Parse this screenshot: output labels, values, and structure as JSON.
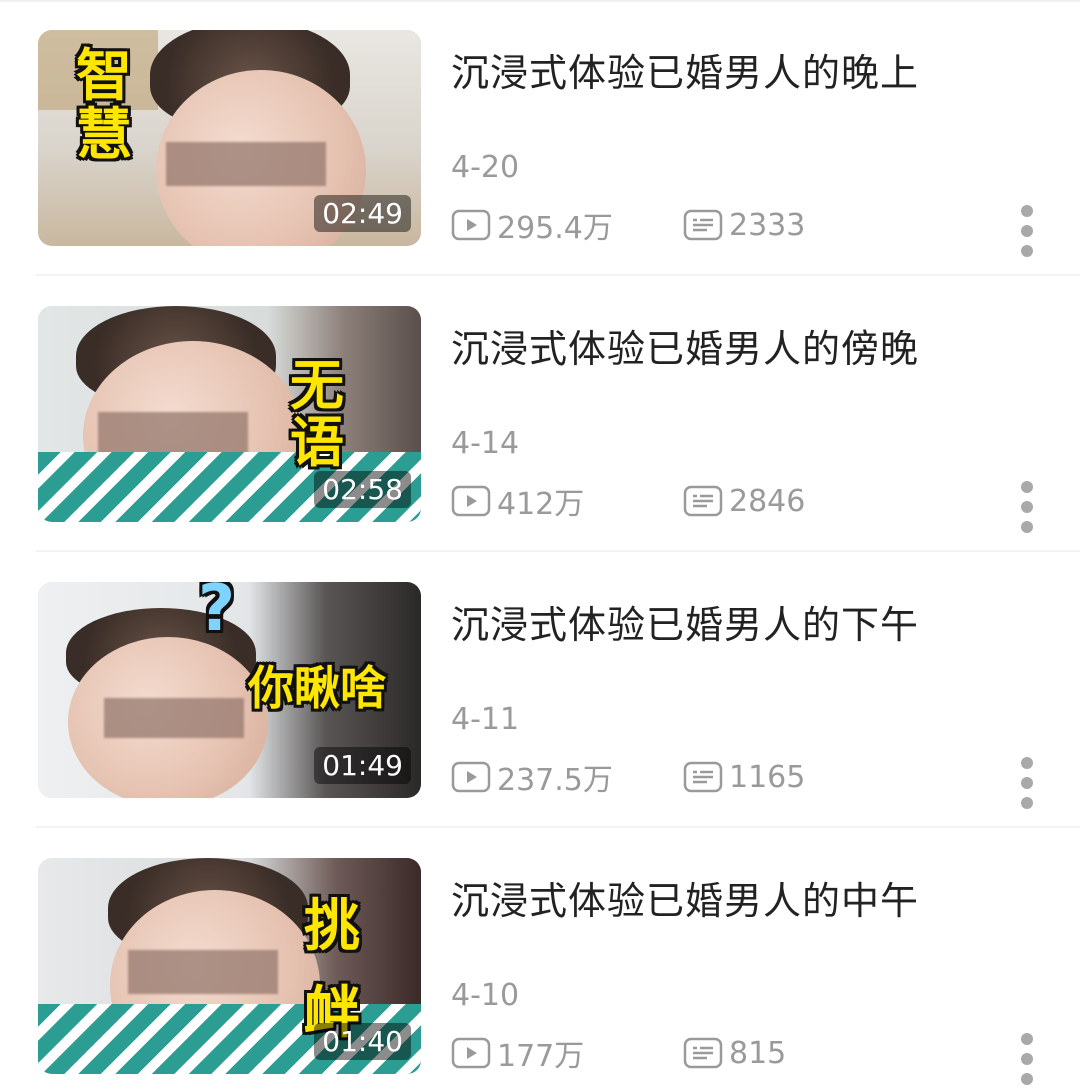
{
  "videos": [
    {
      "title": "沉浸式体验已婚男人的晚上",
      "date": "4-20",
      "plays": "295.4万",
      "danmaku": "2333",
      "duration": "02:49",
      "caption": "智\n慧"
    },
    {
      "title": "沉浸式体验已婚男人的傍晚",
      "date": "4-14",
      "plays": "412万",
      "danmaku": "2846",
      "duration": "02:58",
      "caption": "无\n语"
    },
    {
      "title": "沉浸式体验已婚男人的下午",
      "date": "4-11",
      "plays": "237.5万",
      "danmaku": "1165",
      "duration": "01:49",
      "caption": "你瞅啥",
      "caption_extra": "?"
    },
    {
      "title": "沉浸式体验已婚男人的中午",
      "date": "4-10",
      "plays": "177万",
      "danmaku": "815",
      "duration": "01:40",
      "caption": "挑\n衅"
    }
  ],
  "icons": {
    "plays": "play-count-icon",
    "danmaku": "danmaku-count-icon",
    "more": "more-vertical-icon"
  },
  "colors": {
    "caption_yellow": "#ffe600",
    "meta_gray": "#9a9a9a",
    "title_text": "#222222"
  }
}
